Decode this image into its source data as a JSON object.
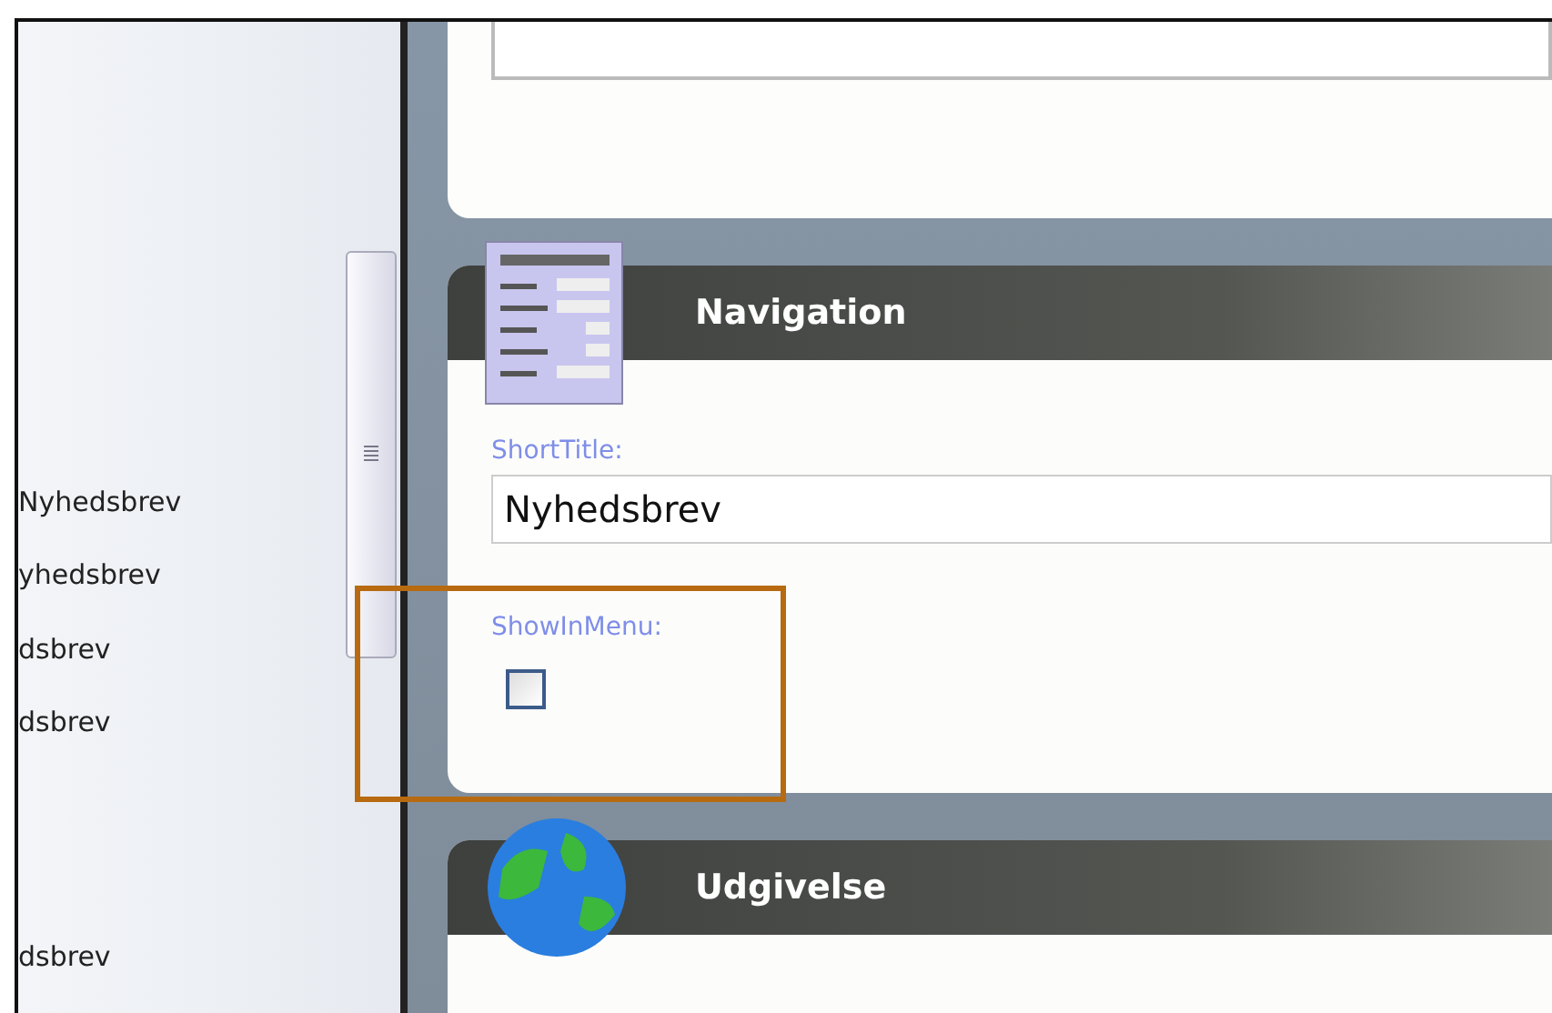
{
  "list_items": [
    {
      "text": "Nyhedsbrev"
    },
    {
      "text": "yhedsbrev"
    },
    {
      "text": "dsbrev"
    },
    {
      "text": "dsbrev"
    },
    {
      "text": "dsbrev"
    }
  ],
  "panels": [
    {
      "kind": "navigation",
      "title": "Navigation",
      "fields": [
        {
          "kind": "text",
          "label": "ShortTitle:",
          "value": "Nyhedsbrev"
        },
        {
          "kind": "checkbox",
          "label": "ShowInMenu:",
          "checked": false
        }
      ]
    },
    {
      "kind": "globe",
      "title": "Udgivelse"
    }
  ]
}
